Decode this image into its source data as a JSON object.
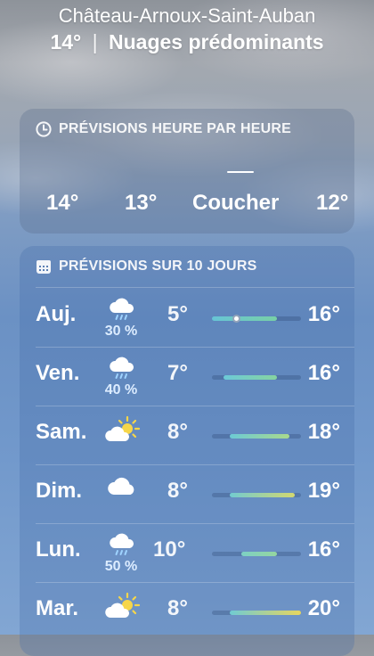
{
  "header": {
    "city": "Château-Arnoux-Saint-Auban",
    "current_temp": "14°",
    "separator": "|",
    "condition": "Nuages prédominants"
  },
  "hourly": {
    "title": "PRÉVISIONS HEURE PAR HEURE",
    "icon": "clock-icon",
    "items": [
      {
        "label": "14°"
      },
      {
        "label": "13°"
      },
      {
        "label": "Coucher"
      },
      {
        "label": "12°"
      }
    ]
  },
  "daily": {
    "title": "PRÉVISIONS SUR 10 JOURS",
    "icon": "calendar-icon",
    "range": [
      5,
      20
    ],
    "days": [
      {
        "day": "Auj.",
        "icon": "rain-cloud-icon",
        "precip": "30 %",
        "low": "5°",
        "high": "16°",
        "low_val": 5,
        "high_val": 16,
        "current_val": 9,
        "fill": [
          "#67c4d6",
          "#78d0a6"
        ]
      },
      {
        "day": "Ven.",
        "icon": "rain-cloud-icon",
        "precip": "40 %",
        "low": "7°",
        "high": "16°",
        "low_val": 7,
        "high_val": 16,
        "fill": [
          "#6cc9d8",
          "#86d3a0"
        ]
      },
      {
        "day": "Sam.",
        "icon": "partly-sunny-icon",
        "precip": "",
        "low": "8°",
        "high": "18°",
        "low_val": 8,
        "high_val": 18,
        "fill": [
          "#6ccad5",
          "#a9d98c"
        ]
      },
      {
        "day": "Dim.",
        "icon": "cloud-icon",
        "precip": "",
        "low": "8°",
        "high": "19°",
        "low_val": 8,
        "high_val": 19,
        "fill": [
          "#72cbd0",
          "#d3d870"
        ]
      },
      {
        "day": "Lun.",
        "icon": "rain-cloud-icon",
        "precip": "50 %",
        "low": "10°",
        "high": "16°",
        "low_val": 10,
        "high_val": 16,
        "fill": [
          "#7dd0c4",
          "#95d6a0"
        ]
      },
      {
        "day": "Mar.",
        "icon": "partly-sunny-icon",
        "precip": "",
        "low": "8°",
        "high": "20°",
        "low_val": 8,
        "high_val": 20,
        "fill": [
          "#70cbd3",
          "#e7d65e"
        ]
      }
    ]
  }
}
